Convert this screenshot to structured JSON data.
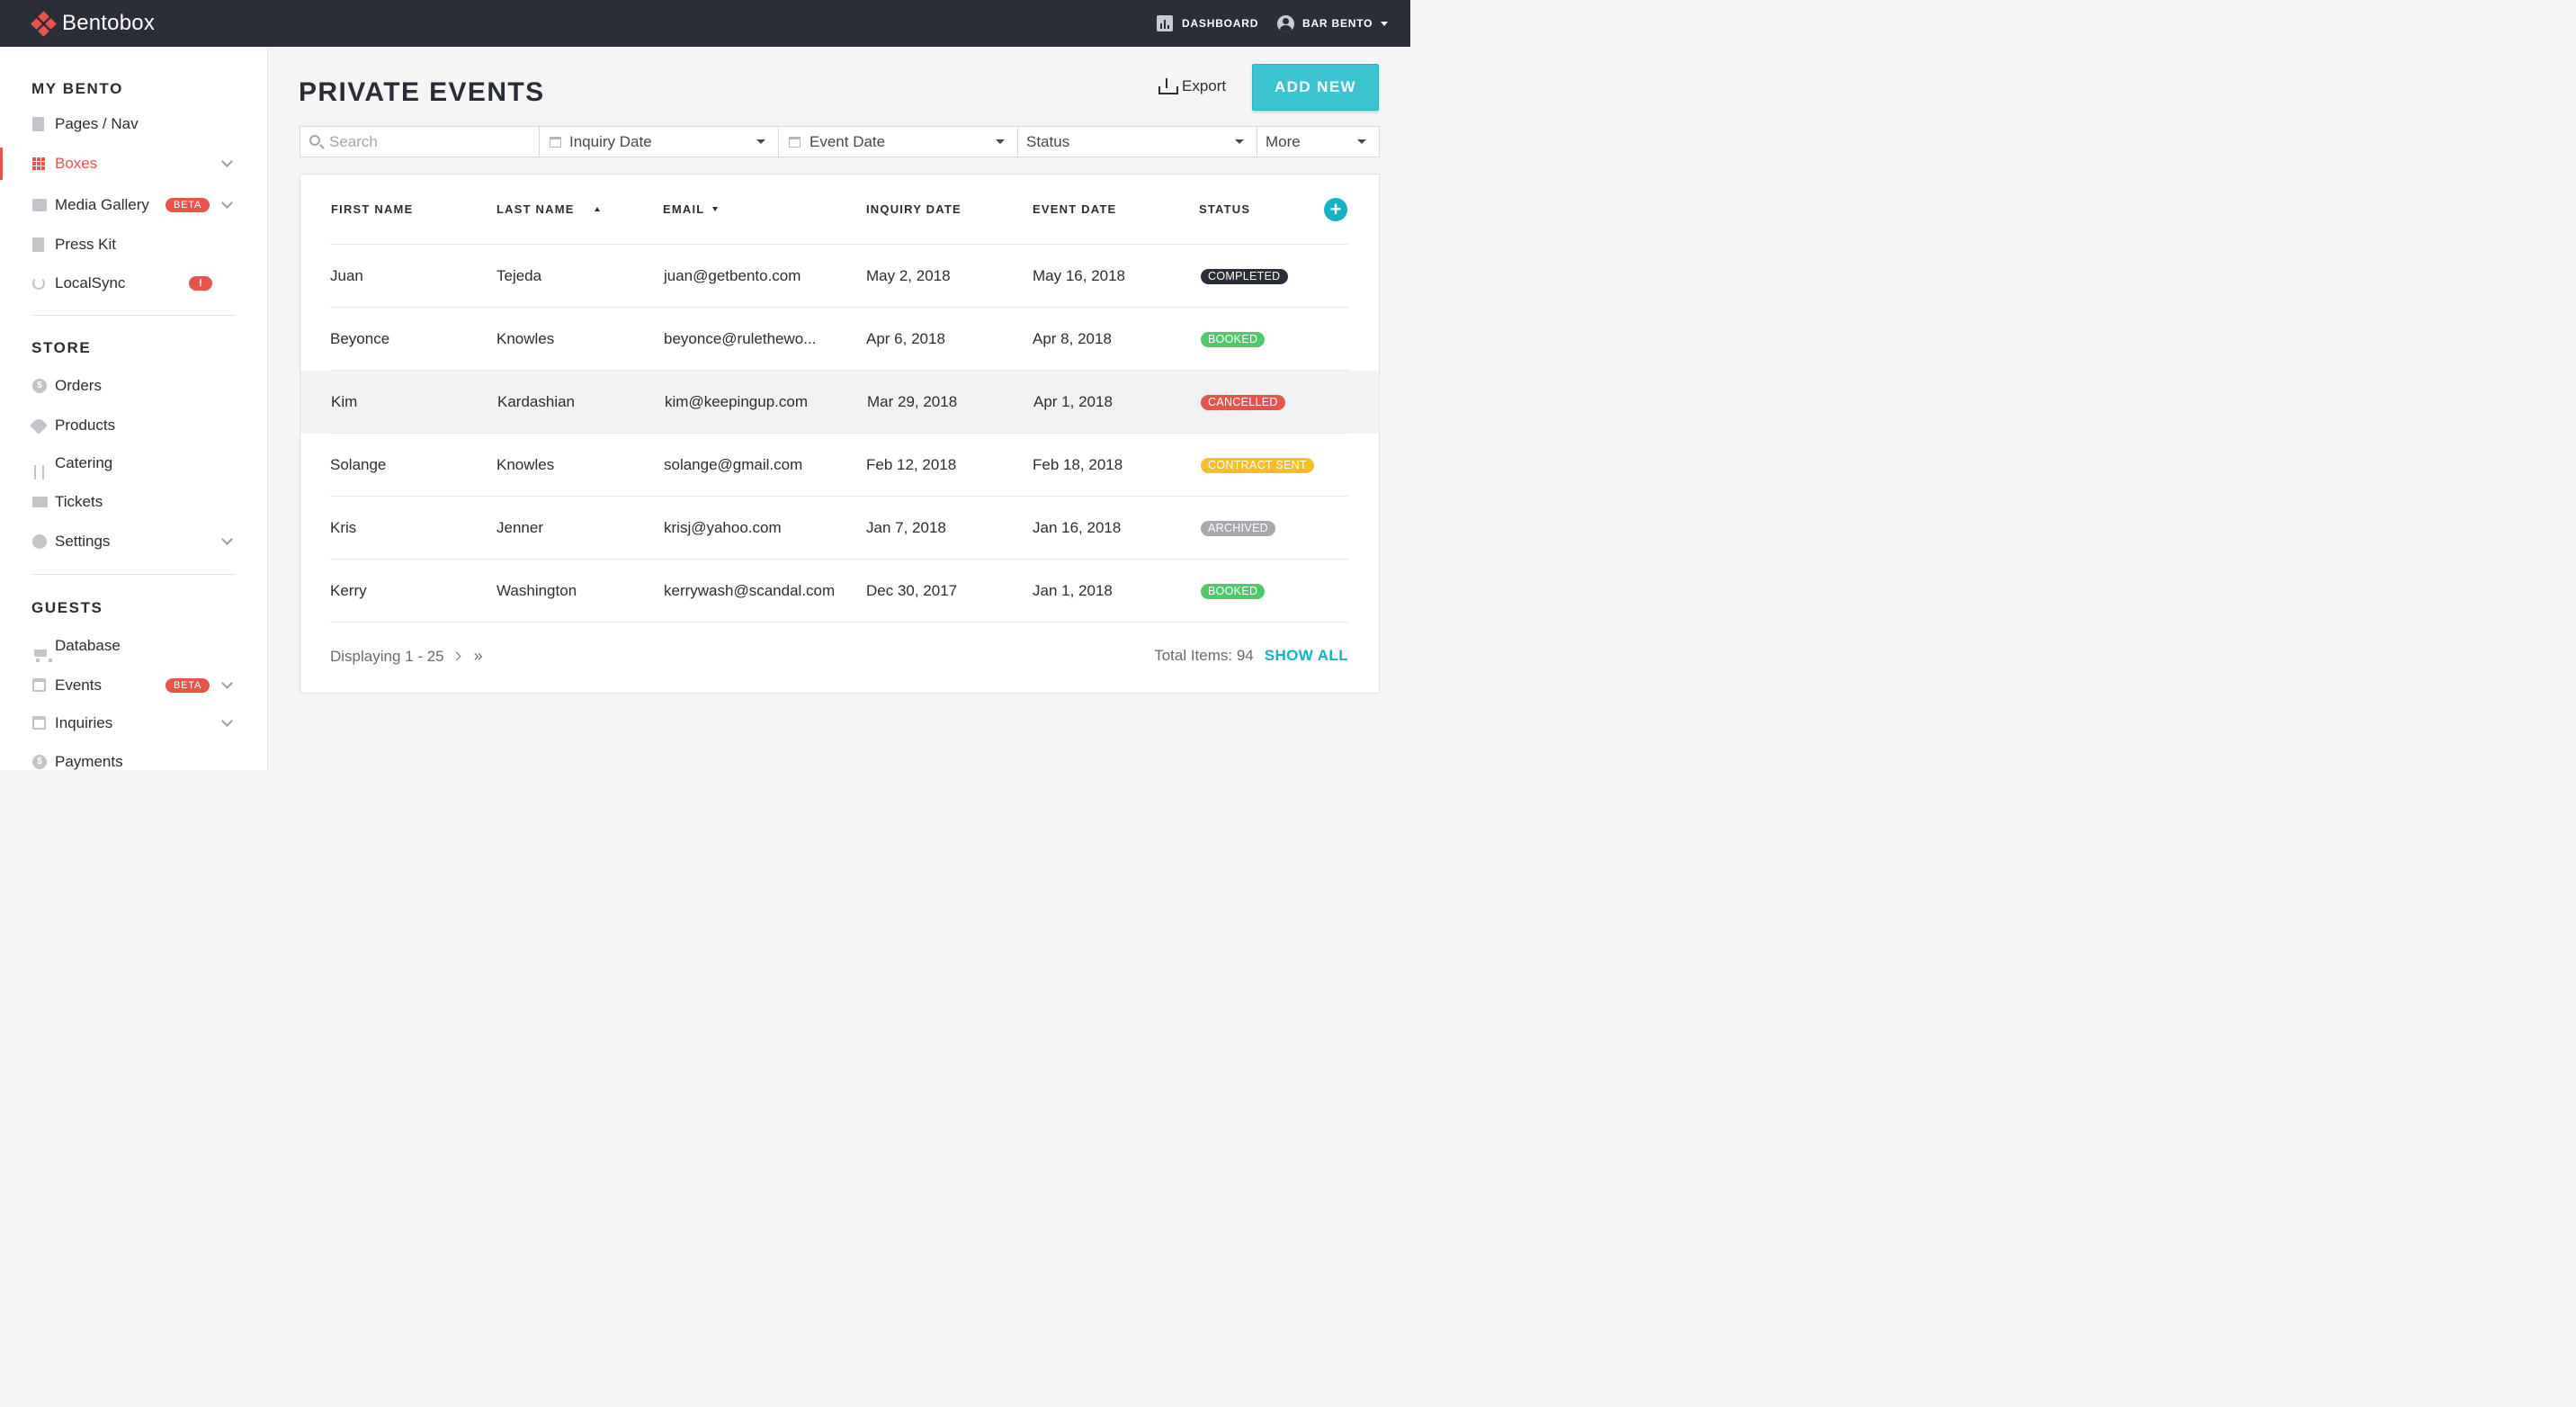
{
  "app": {
    "name": "Bentobox"
  },
  "topbar": {
    "dashboard_label": "DASHBOARD",
    "account_label": "BAR BENTO"
  },
  "sidebar": {
    "sections": [
      {
        "title": "MY BENTO",
        "items": [
          {
            "label": "Pages / Nav",
            "icon": "page-icon"
          },
          {
            "label": "Boxes",
            "icon": "grid-icon",
            "active": true,
            "expandable": true
          },
          {
            "label": "Media Gallery",
            "icon": "image-icon",
            "badge": "BETA",
            "expandable": true
          },
          {
            "label": "Press Kit",
            "icon": "document-icon"
          },
          {
            "label": "LocalSync",
            "icon": "sync-icon",
            "alert": "!"
          }
        ]
      },
      {
        "title": "STORE",
        "items": [
          {
            "label": "Orders",
            "icon": "dollar-icon"
          },
          {
            "label": "Products",
            "icon": "tag-icon"
          },
          {
            "label": "Catering",
            "icon": "utensils-icon"
          },
          {
            "label": "Tickets",
            "icon": "ticket-icon"
          },
          {
            "label": "Settings",
            "icon": "gear-icon",
            "expandable": true
          }
        ]
      },
      {
        "title": "GUESTS",
        "items": [
          {
            "label": "Database",
            "icon": "cart-icon"
          },
          {
            "label": "Events",
            "icon": "calendar-icon",
            "badge": "BETA",
            "expandable": true
          },
          {
            "label": "Inquiries",
            "icon": "calendar-check-icon",
            "expandable": true
          },
          {
            "label": "Payments",
            "icon": "dollar-icon"
          }
        ]
      }
    ]
  },
  "main": {
    "title": "PRIVATE EVENTS",
    "export_label": "Export",
    "add_new_label": "ADD NEW",
    "filters": {
      "search_placeholder": "Search",
      "inquiry_date": "Inquiry Date",
      "event_date": "Event Date",
      "status": "Status",
      "more": "More"
    },
    "table": {
      "columns": [
        "FIRST NAME",
        "LAST NAME",
        "EMAIL",
        "INQUIRY DATE",
        "EVENT DATE",
        "STATUS"
      ],
      "rows": [
        {
          "first": "Juan",
          "last": "Tejeda",
          "email": "juan@getbento.com",
          "inquiry": "May 2, 2018",
          "event": "May 16, 2018",
          "status": "COMPLETED",
          "status_color": "#2b2e38"
        },
        {
          "first": "Beyonce",
          "last": "Knowles",
          "email": "beyonce@rulethewo...",
          "inquiry": "Apr 6, 2018",
          "event": "Apr 8, 2018",
          "status": "BOOKED",
          "status_color": "#4cc96b"
        },
        {
          "first": "Kim",
          "last": "Kardashian",
          "email": "kim@keepingup.com",
          "inquiry": "Mar 29, 2018",
          "event": "Apr 1, 2018",
          "status": "CANCELLED",
          "status_color": "#e8534a"
        },
        {
          "first": "Solange",
          "last": "Knowles",
          "email": "solange@gmail.com",
          "inquiry": "Feb 12, 2018",
          "event": "Feb 18, 2018",
          "status": "CONTRACT SENT",
          "status_color": "#f5be2c"
        },
        {
          "first": "Kris",
          "last": "Jenner",
          "email": "krisj@yahoo.com",
          "inquiry": "Jan 7, 2018",
          "event": "Jan 16, 2018",
          "status": "ARCHIVED",
          "status_color": "#a6a8ad"
        },
        {
          "first": "Kerry",
          "last": "Washington",
          "email": "kerrywash@scandal.com",
          "inquiry": "Dec 30, 2017",
          "event": "Jan 1, 2018",
          "status": "BOOKED",
          "status_color": "#4cc96b"
        }
      ]
    },
    "pagination": {
      "displaying": "Displaying 1 - 25",
      "last_label": "»",
      "total": "Total Items: 94",
      "show_all": "SHOW ALL"
    }
  },
  "colors": {
    "brand": "#e8534a",
    "accent": "#3bc4d0",
    "topbar": "#2b2e38"
  }
}
